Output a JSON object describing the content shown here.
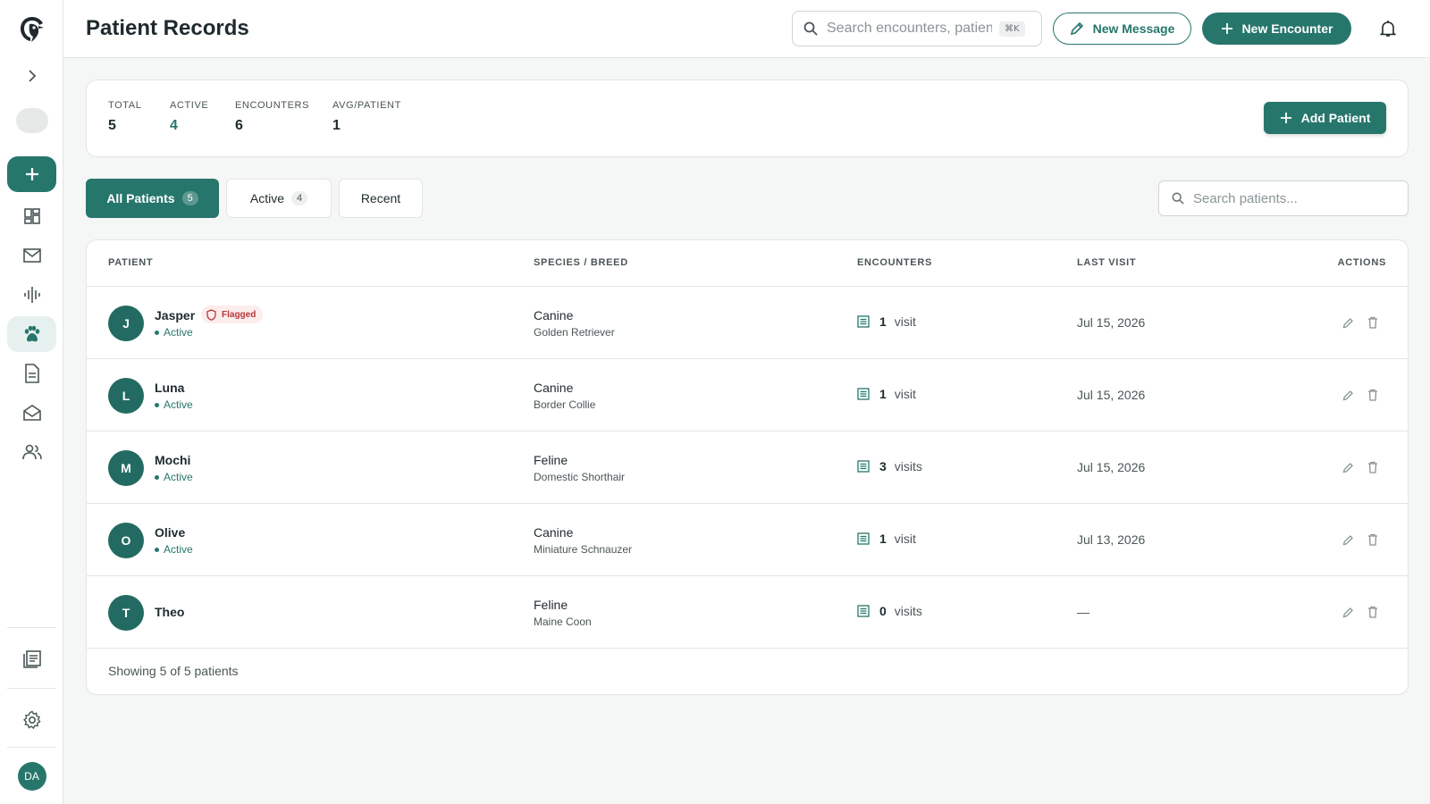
{
  "header": {
    "title": "Patient Records",
    "search_placeholder": "Search encounters, patients...",
    "shortcut": "⌘K",
    "new_message_label": "New Message",
    "new_encounter_label": "New Encounter"
  },
  "sidebar": {
    "user_initials": "DA",
    "items": [
      {
        "name": "dashboard",
        "icon": "dashboard-icon"
      },
      {
        "name": "messages",
        "icon": "mail-icon"
      },
      {
        "name": "audio",
        "icon": "waveform-icon"
      },
      {
        "name": "patients",
        "icon": "paw-icon",
        "active": true
      },
      {
        "name": "documents",
        "icon": "document-icon"
      },
      {
        "name": "inbox",
        "icon": "inbox-icon"
      },
      {
        "name": "team",
        "icon": "people-icon"
      },
      {
        "name": "notes",
        "icon": "notes-icon"
      },
      {
        "name": "settings",
        "icon": "gear-icon"
      }
    ]
  },
  "stats": {
    "total_label": "TOTAL",
    "total_value": "5",
    "active_label": "ACTIVE",
    "active_value": "4",
    "encounters_label": "ENCOUNTERS",
    "encounters_value": "6",
    "avg_label": "AVG/PATIENT",
    "avg_value": "1",
    "add_label": "Add Patient"
  },
  "tabs": [
    {
      "label": "All Patients",
      "count": "5",
      "active": true
    },
    {
      "label": "Active",
      "count": "4",
      "active": false
    },
    {
      "label": "Recent",
      "count": "",
      "active": false
    }
  ],
  "patient_search_placeholder": "Search patients...",
  "table": {
    "headers": {
      "patient": "PATIENT",
      "species": "SPECIES / BREED",
      "encounters": "ENCOUNTERS",
      "last_visit": "LAST VISIT",
      "actions": "ACTIONS"
    },
    "rows": [
      {
        "initial": "J",
        "name": "Jasper",
        "flag": "Flagged",
        "status": "Active",
        "species": "Canine",
        "breed": "Golden Retriever",
        "enc_count": "1",
        "enc_unit": "visit",
        "last_visit": "Jul 15, 2026"
      },
      {
        "initial": "L",
        "name": "Luna",
        "flag": "",
        "status": "Active",
        "species": "Canine",
        "breed": "Border Collie",
        "enc_count": "1",
        "enc_unit": "visit",
        "last_visit": "Jul 15, 2026"
      },
      {
        "initial": "M",
        "name": "Mochi",
        "flag": "",
        "status": "Active",
        "species": "Feline",
        "breed": "Domestic Shorthair",
        "enc_count": "3",
        "enc_unit": "visits",
        "last_visit": "Jul 15, 2026"
      },
      {
        "initial": "O",
        "name": "Olive",
        "flag": "",
        "status": "Active",
        "species": "Canine",
        "breed": "Miniature Schnauzer",
        "enc_count": "1",
        "enc_unit": "visit",
        "last_visit": "Jul 13, 2026"
      },
      {
        "initial": "T",
        "name": "Theo",
        "flag": "",
        "status": "",
        "species": "Feline",
        "breed": "Maine Coon",
        "enc_count": "0",
        "enc_unit": "visits",
        "last_visit": "—"
      }
    ],
    "footer": "Showing 5 of 5 patients"
  },
  "colors": {
    "accent": "#27766c",
    "flag_bg": "#fdecec",
    "flag_text": "#b5383c"
  }
}
